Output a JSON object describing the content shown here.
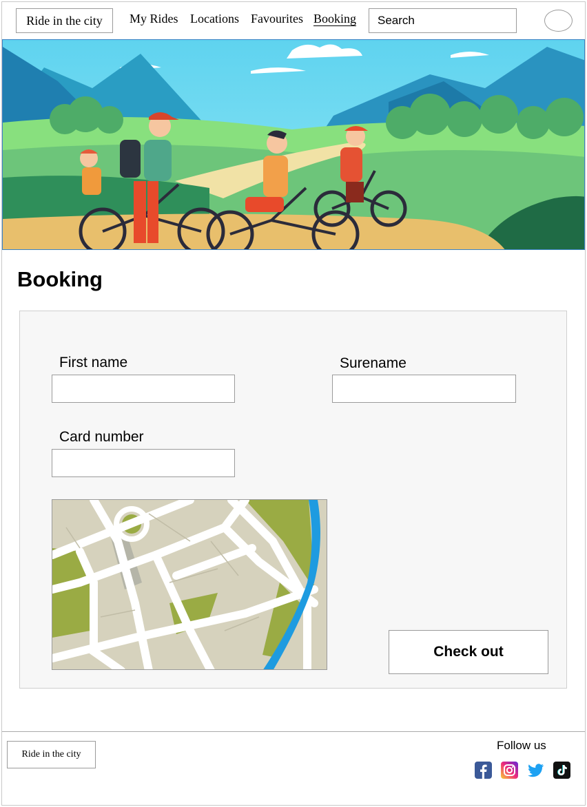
{
  "header": {
    "logo_text": "Ride in the city",
    "nav": [
      {
        "label": "My Rides"
      },
      {
        "label": "Locations"
      },
      {
        "label": "Favourites"
      },
      {
        "label": "Booking",
        "active": true
      }
    ],
    "search_value": "Search"
  },
  "page": {
    "title": "Booking"
  },
  "form": {
    "first_name_label": "First name",
    "surname_label": "Surename",
    "card_number_label": "Card number",
    "first_name_value": "",
    "surname_value": "",
    "card_number_value": "",
    "checkout_label": "Check out"
  },
  "footer": {
    "logo_text": "Ride in the city",
    "follow_label": "Follow us",
    "social": [
      "facebook-icon",
      "instagram-icon",
      "twitter-icon",
      "tiktok-icon"
    ]
  },
  "colors": {
    "hero_border": "#3b82c4",
    "facebook": "#3b5998",
    "twitter": "#1da1f2",
    "tiktok": "#111111"
  }
}
